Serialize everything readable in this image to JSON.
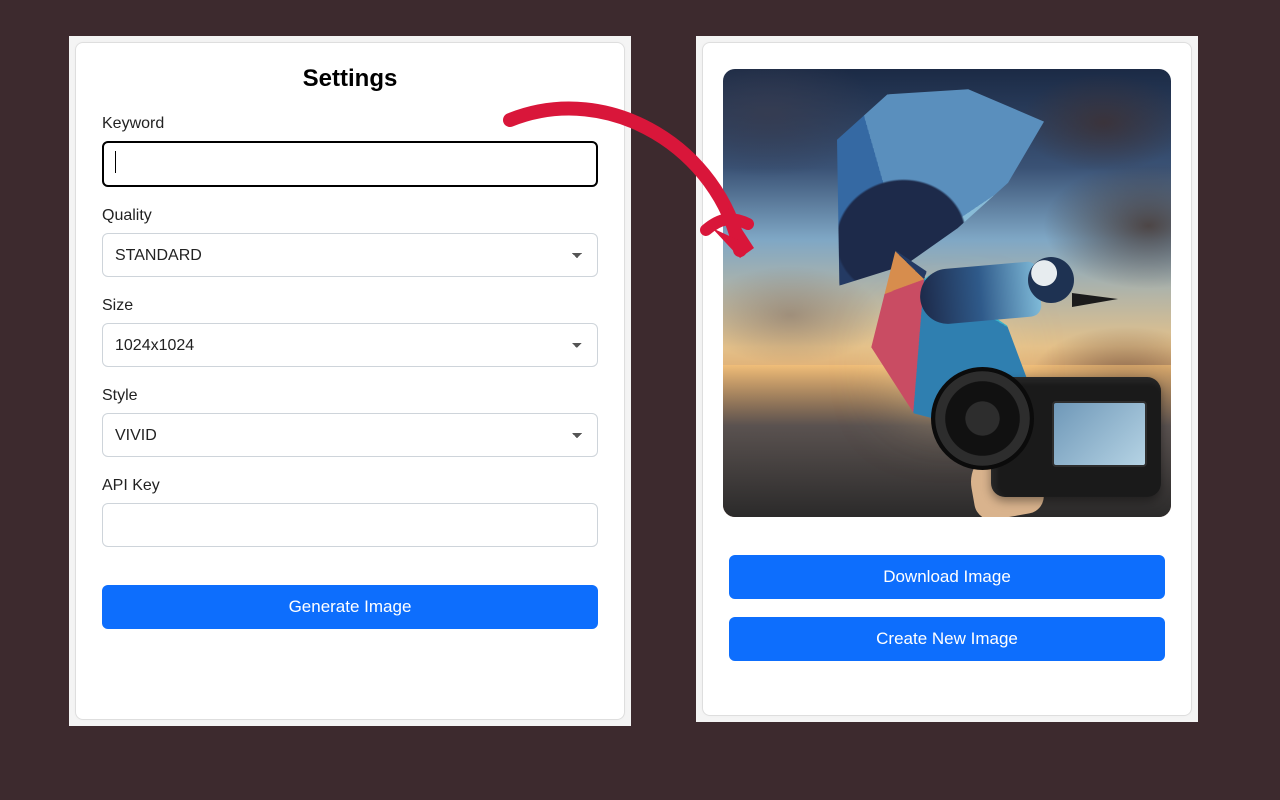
{
  "settings": {
    "title": "Settings",
    "keyword_label": "Keyword",
    "keyword_value": "",
    "quality_label": "Quality",
    "quality_value": "STANDARD",
    "size_label": "Size",
    "size_value": "1024x1024",
    "style_label": "Style",
    "style_value": "VIVID",
    "apikey_label": "API Key",
    "apikey_value": "",
    "generate_label": "Generate Image"
  },
  "result": {
    "download_label": "Download Image",
    "create_new_label": "Create New Image",
    "image_description": "AI-generated colorful bird with spread wings flying at sunset over water, with a DSLR camera held in hand in the foreground"
  }
}
